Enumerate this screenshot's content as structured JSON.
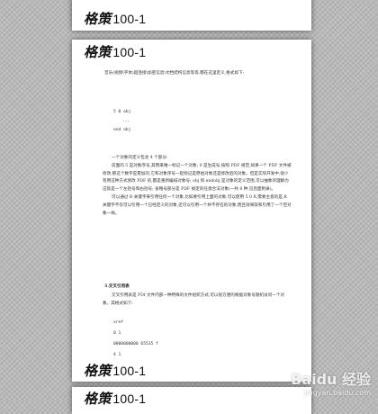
{
  "header": {
    "brand_script": "格策",
    "brand_num": "100-1"
  },
  "doc": {
    "intro_line": "音乐(视频\\字体)超连接\\加密信息\\文档结构信息等等,都在这里定义,格式如下:",
    "code1": [
      "5 0 obj",
      "...",
      "end obj"
    ],
    "p1": "一个对象的定义包含 4 个部分:",
    "p2": "前面的 5 是对象序号,其用来唯一标记一个对象; 0 是生成号,按照 PDF 规范,如果一个 PDF 文件被修改,那这个数字是累加的,它和对象序号一起标记是原始对象还是修改后的对象。但是实际开发中,很少有用这种方式修改 PDF 的,都是重新编排对象号; obj 和 endobj 是对象的定义范围,可以抽象的理解为这就是一个左括号和右括号; 省略号部分是 PDF 规定的任意合法对象(一共 8 种,见后面附录)。",
    "p3": "可以通过 R 关键字来引用任何一个对象,比如要引用上面的对象,可以使用 5 0 R,需要主意的是,R 关键字不仅可以引用一个已经定义的对象,还可以引用一个并不存在的对象,而且效果就和引用了一个空对象一样。",
    "section": "3.交叉引用表",
    "p4": "交叉引用表是 PDf 文件内部一种特殊的文件组织方式,可以很方便的根据对象号随机访问一个对象。其格式如下:",
    "code2": [
      "xref",
      "0 1",
      "0000000000      65535      f",
      "4 1"
    ]
  },
  "footer": {
    "brand_script": "格策",
    "brand_num": "100-1"
  },
  "bottom_page": {
    "brand_script": "格策",
    "brand_num": "100-1"
  },
  "watermark": {
    "text": "Baidu 经验",
    "url": "jingyan.baidu.com"
  }
}
